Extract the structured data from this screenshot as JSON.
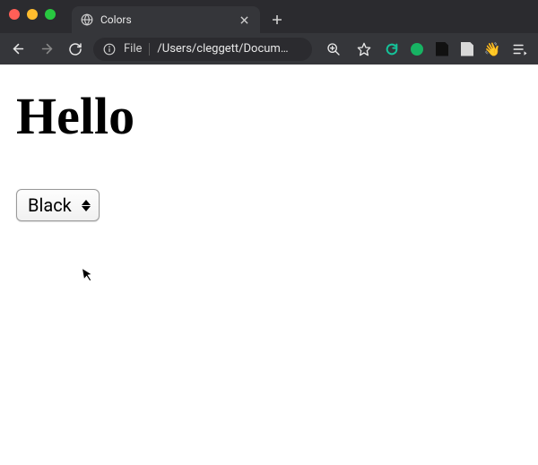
{
  "browser": {
    "tab": {
      "title": "Colors"
    },
    "address": {
      "scheme": "File",
      "path": "/Users/cleggett/Docum…"
    }
  },
  "page": {
    "heading": "Hello",
    "select_value": "Black"
  }
}
